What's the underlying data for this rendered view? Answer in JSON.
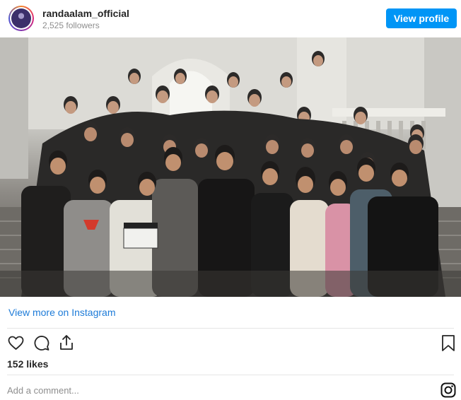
{
  "header": {
    "username": "randaalam_official",
    "followers": "2,525 followers",
    "view_profile_label": "View profile"
  },
  "post": {
    "image_alt": "Group photo of film cast and crew on steps"
  },
  "footer": {
    "view_more_label": "View more on Instagram",
    "likes": "152 likes",
    "comment_placeholder": "Add a comment..."
  },
  "icons": {
    "like": "heart-icon",
    "comment": "comment-bubble-icon",
    "share": "share-icon",
    "save": "bookmark-icon",
    "brand": "instagram-icon"
  },
  "colors": {
    "accent": "#0095f6",
    "link": "#1d7bd8",
    "muted": "#8e8e8e",
    "text": "#262626"
  }
}
